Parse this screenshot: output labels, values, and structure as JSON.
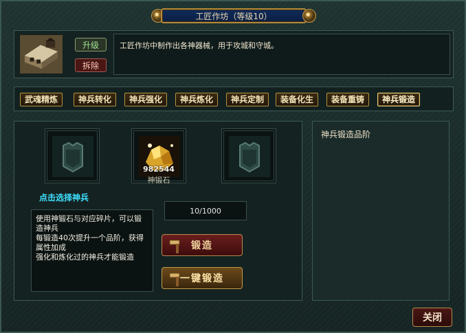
{
  "window": {
    "title": "工匠作坊（等级10）",
    "description": "工匠作坊中制作出各神器械，用于攻城和守城。",
    "buttons": {
      "upgrade": "升级",
      "demolish": "拆除",
      "close": "关闭"
    }
  },
  "tabs": [
    {
      "label": "武魂精炼"
    },
    {
      "label": "神兵转化"
    },
    {
      "label": "神兵强化"
    },
    {
      "label": "神兵炼化"
    },
    {
      "label": "神兵定制"
    },
    {
      "label": "装备化生"
    },
    {
      "label": "装备重铸"
    },
    {
      "label": "神兵锻造",
      "active": true
    }
  ],
  "forge": {
    "select_weapon": "点击选择神兵",
    "stone": {
      "count": "982544",
      "label": "神锻石"
    },
    "progress": "10/1000",
    "info_lines": [
      "使用神锻石与对应碎片，可以锻造神兵",
      "每锻造40次提升一个品阶，获得属性加成",
      "强化和炼化过的神兵才能锻造"
    ],
    "buttons": {
      "forge": "锻造",
      "forge_all": "一键锻造"
    },
    "grade_panel_title": "神兵锻造品阶"
  },
  "colors": {
    "link": "#3fe0ff",
    "tab_border": "#b8923f",
    "panel_bg": "#142221"
  }
}
